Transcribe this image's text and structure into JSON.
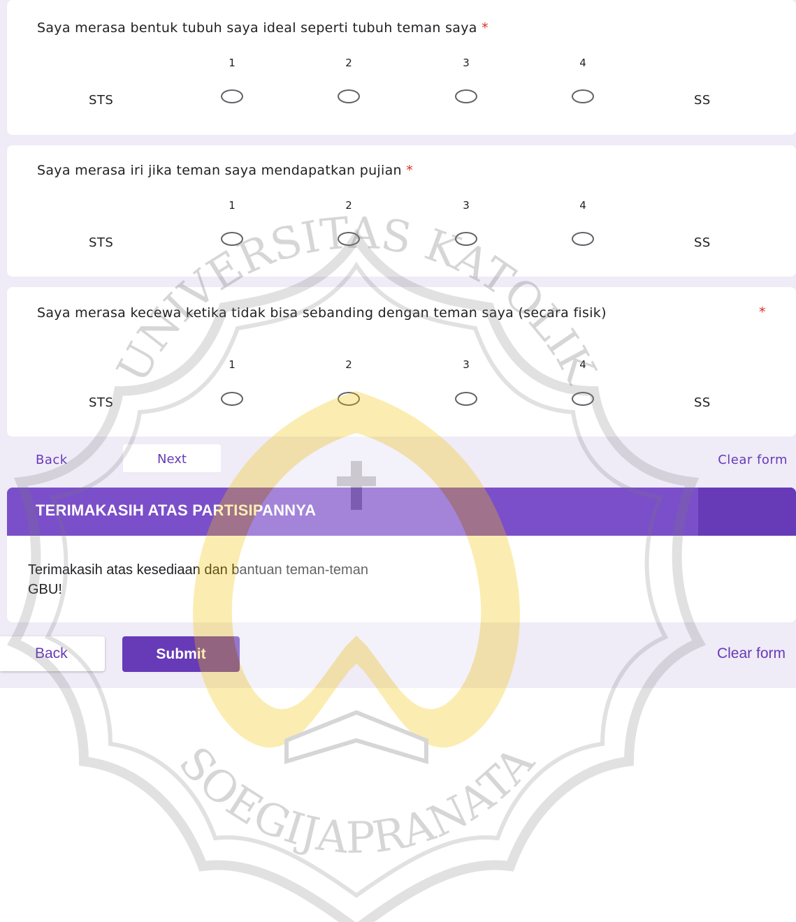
{
  "questions": [
    {
      "title": "Saya merasa bentuk tubuh saya ideal seperti tubuh teman saya",
      "required_mark": "*",
      "scale": [
        "1",
        "2",
        "3",
        "4"
      ],
      "low_label": "STS",
      "high_label": "SS"
    },
    {
      "title": "Saya merasa iri jika teman saya mendapatkan pujian",
      "required_mark": "*",
      "scale": [
        "1",
        "2",
        "3",
        "4"
      ],
      "low_label": "STS",
      "high_label": "SS"
    },
    {
      "title": "Saya merasa kecewa ketika tidak bisa sebanding dengan teman saya (secara fisik)",
      "required_mark": "*",
      "scale": [
        "1",
        "2",
        "3",
        "4"
      ],
      "low_label": "STS",
      "high_label": "SS"
    }
  ],
  "nav1": {
    "back_label": "Back",
    "next_label": "Next",
    "clear_label": "Clear form"
  },
  "section": {
    "title": "TERIMAKASIH ATAS PARTISIPANNYA",
    "description": "Terimakasih atas kesediaan dan bantuan teman-teman\nGBU!"
  },
  "nav2": {
    "back_label": "Back",
    "submit_label": "Submit",
    "clear_label": "Clear form"
  },
  "watermark": {
    "text_top": "UNIVERSITAS KATOLIK",
    "text_bottom": "SOEGIJAPRANATA"
  },
  "colors": {
    "accent": "#673ab7",
    "header_light": "#7b4fc9",
    "form_background": "#efebf7",
    "required": "#d93025",
    "watermark_gold": "#f5c400"
  }
}
